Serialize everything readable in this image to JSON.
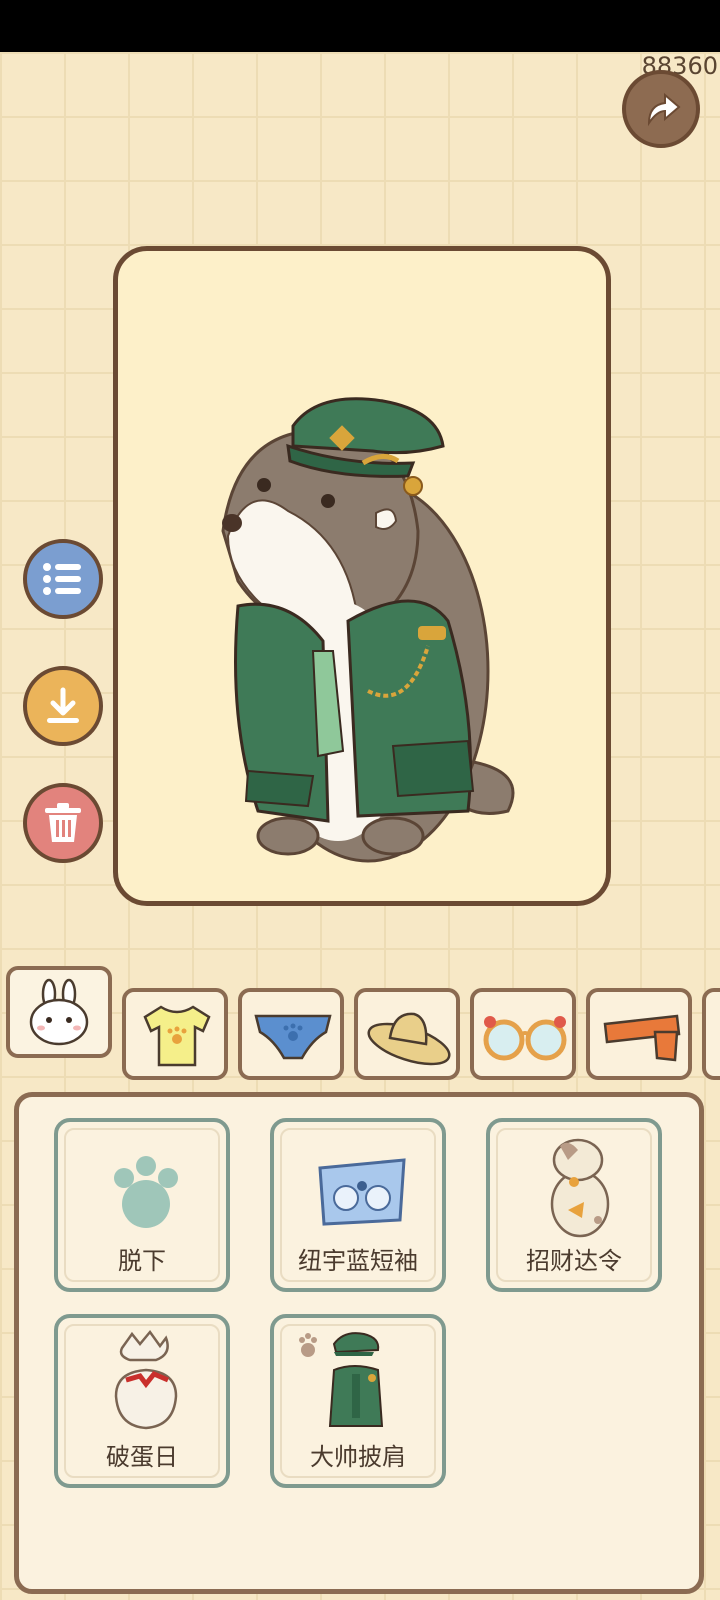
{
  "status_bar": {},
  "score": {
    "value": "88360"
  },
  "side_buttons": {
    "list_icon": "list-icon",
    "download_icon": "download-icon",
    "trash_icon": "trash-icon"
  },
  "tabs": [
    {
      "icon": "rabbit-icon",
      "active": true
    },
    {
      "icon": "tshirt-icon",
      "active": false
    },
    {
      "icon": "underpants-icon",
      "active": false
    },
    {
      "icon": "straw-hat-icon",
      "active": false
    },
    {
      "icon": "glasses-icon",
      "active": false
    },
    {
      "icon": "scarf-icon",
      "active": false
    }
  ],
  "items": [
    {
      "label": "脱下",
      "icon": "paw-icon"
    },
    {
      "label": "纽宇蓝短袖",
      "icon": "blue-shirt-icon"
    },
    {
      "label": "招财达令",
      "icon": "lucky-cat-costume-icon"
    },
    {
      "label": "破蛋日",
      "icon": "eggshell-icon"
    },
    {
      "label": "大帅披肩",
      "icon": "military-cape-icon"
    }
  ],
  "colors": {
    "background": "#f7e8c6",
    "border_brown": "#6b4a33",
    "item_border": "#7f9a8f",
    "coat_green": "#3f7a57"
  }
}
